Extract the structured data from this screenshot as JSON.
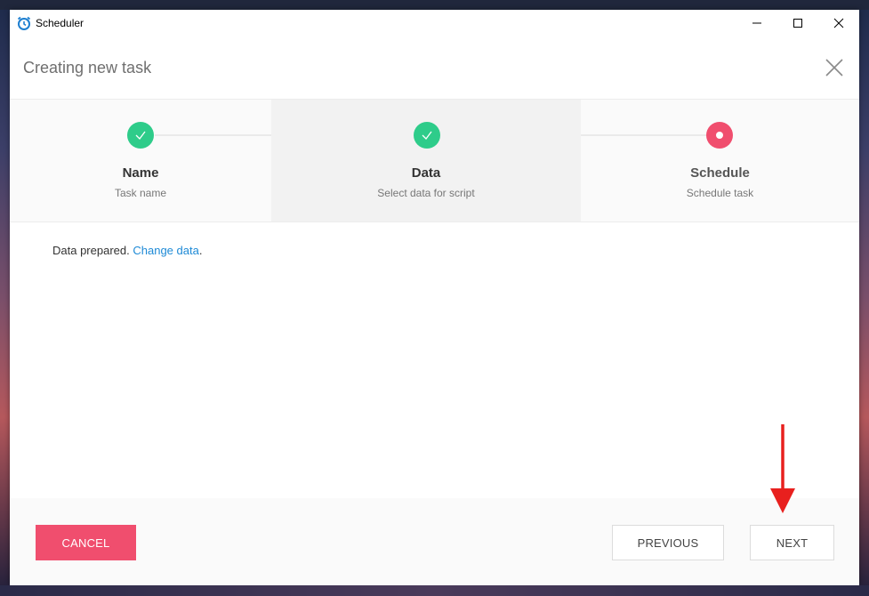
{
  "window": {
    "app_title": "Scheduler",
    "controls": [
      "minimize",
      "maximize",
      "close"
    ]
  },
  "dialog": {
    "title": "Creating new task"
  },
  "steps": [
    {
      "name": "Name",
      "subtitle": "Task name",
      "state": "done"
    },
    {
      "name": "Data",
      "subtitle": "Select data for script",
      "state": "done"
    },
    {
      "name": "Schedule",
      "subtitle": "Schedule task",
      "state": "active"
    }
  ],
  "content": {
    "status_text": "Data prepared.",
    "change_link": "Change data",
    "period": "."
  },
  "footer": {
    "cancel_label": "CANCEL",
    "previous_label": "PREVIOUS",
    "next_label": "NEXT"
  },
  "colors": {
    "done": "#2ecc8a",
    "active": "#f04e6e",
    "link": "#1e8ad6",
    "annotation_arrow": "#e8201e"
  }
}
